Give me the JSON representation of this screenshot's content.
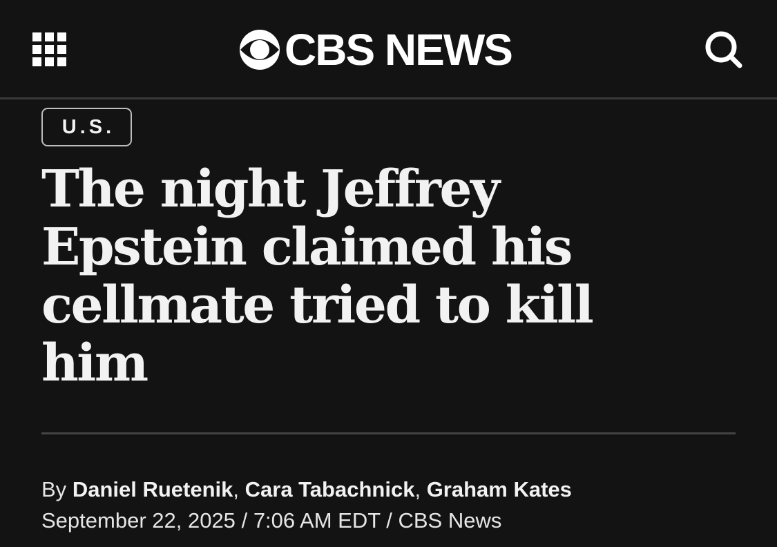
{
  "header": {
    "menu_icon": "grid-menu-icon",
    "logo_icon": "cbs-eye-icon",
    "logo_text": "CBS NEWS",
    "search_icon": "search-icon"
  },
  "colors": {
    "background": "#131313",
    "text": "#f2f2f2",
    "divider": "#444444",
    "tag_border": "#bdbdbd"
  },
  "article": {
    "section": "U.S.",
    "headline_lines": [
      "The night Jeffrey",
      "Epstein claimed his",
      "cellmate tried to kill",
      "him"
    ],
    "byline_prefix": "By",
    "authors": [
      "Daniel Ruetenik",
      "Cara Tabachnick",
      "Graham Kates"
    ],
    "author_separator": ",",
    "date": "September 22, 2025",
    "time": "7:06 AM EDT",
    "source": "CBS News",
    "meta_separator": "/"
  }
}
